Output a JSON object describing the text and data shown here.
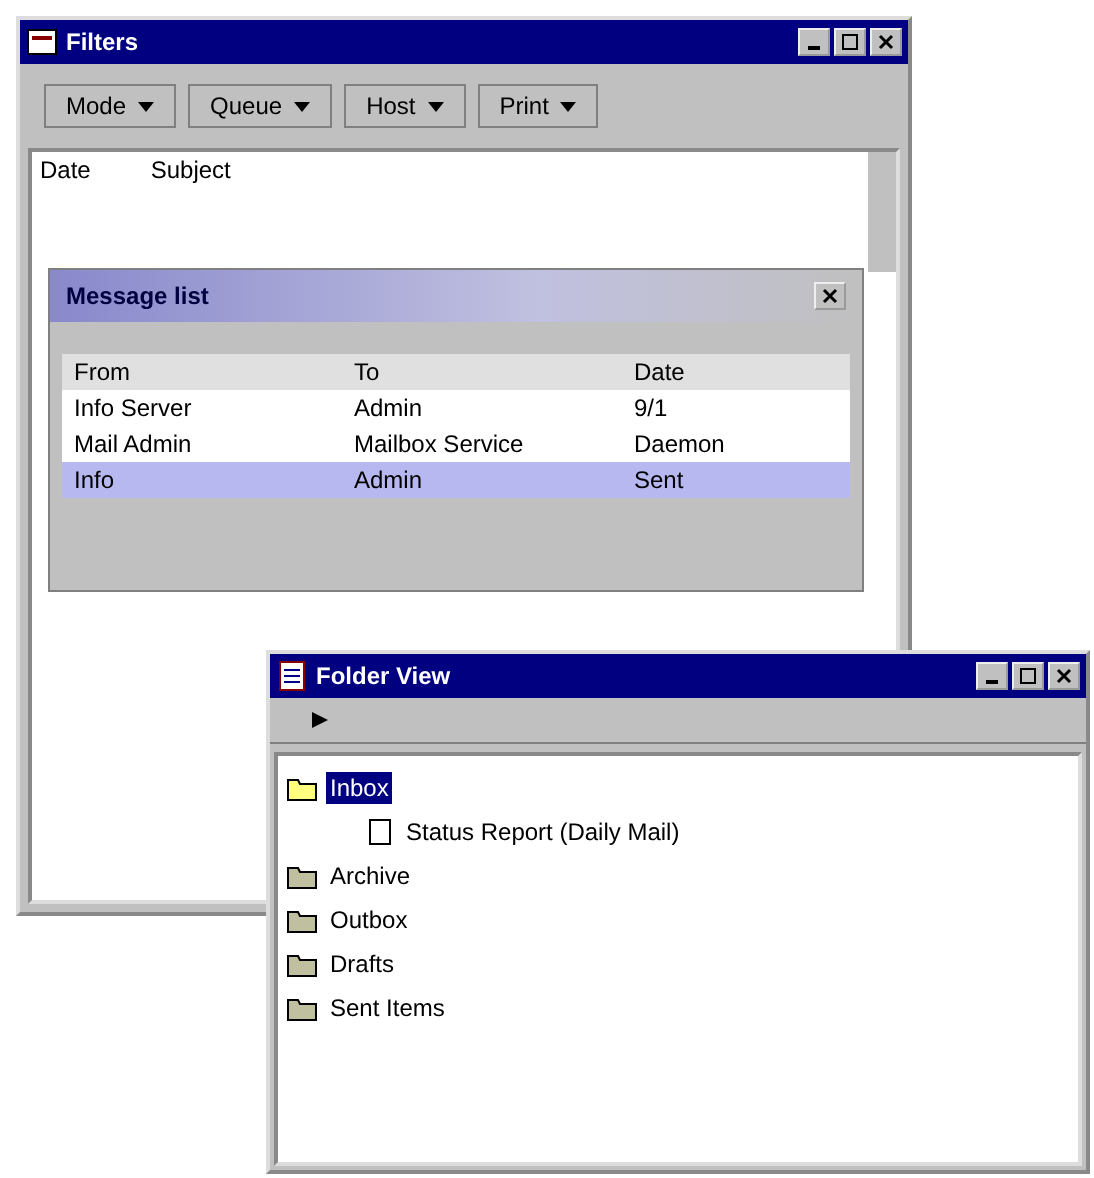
{
  "main_window": {
    "title": "Filters",
    "toolbar": [
      {
        "label": "Mode"
      },
      {
        "label": "Queue"
      },
      {
        "label": "Host"
      },
      {
        "label": "Print"
      }
    ],
    "list_header": [
      "Date",
      "Subject"
    ],
    "panel": {
      "title": "Message list",
      "columns": [
        "From",
        "To",
        "Date"
      ],
      "rows": [
        {
          "cells": [
            "Info Server",
            "Admin",
            "9/1"
          ],
          "selected": false
        },
        {
          "cells": [
            "Mail Admin",
            "Mailbox Service",
            "Daemon"
          ],
          "selected": false
        },
        {
          "cells": [
            "Info",
            "Admin",
            "Sent"
          ],
          "selected": true
        }
      ]
    }
  },
  "tree_window": {
    "title": "Folder View",
    "items": [
      {
        "label": "Inbox",
        "selected": true,
        "expanded": true,
        "children": [
          {
            "label": "Status Report (Daily Mail)",
            "selected": false
          }
        ]
      },
      {
        "label": "Archive",
        "selected": false,
        "expanded": false
      },
      {
        "label": "Outbox",
        "selected": false,
        "expanded": false
      },
      {
        "label": "Drafts",
        "selected": false,
        "expanded": false
      },
      {
        "label": "Sent Items",
        "selected": false,
        "expanded": false
      }
    ]
  }
}
